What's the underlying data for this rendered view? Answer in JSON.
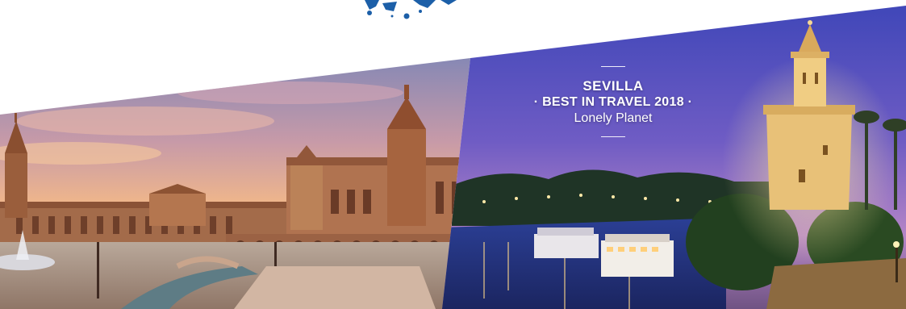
{
  "banner": {
    "city": "SEVILLA",
    "award": "· BEST IN TRAVEL 2018 ·",
    "source": "Lonely Planet"
  },
  "colors": {
    "brand_blue": "#1c5fa8",
    "text": "#ffffff"
  },
  "images": {
    "left_photo": "plaza-de-espana-sunset-photo",
    "right_photo": "torre-del-oro-river-night-photo",
    "top_mark": "blue-splash-logo-fragment"
  }
}
